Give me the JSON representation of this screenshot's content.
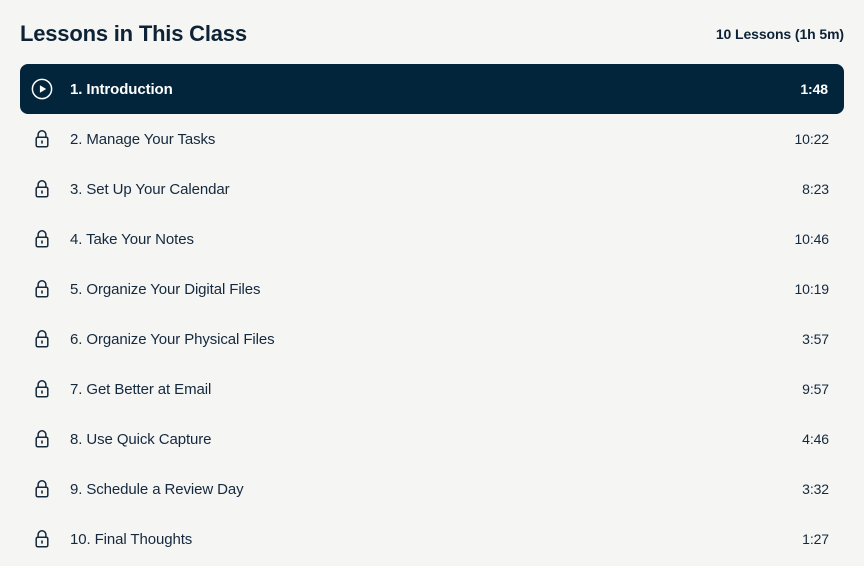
{
  "header": {
    "title": "Lessons in This Class",
    "meta": "10 Lessons (1h 5m)"
  },
  "colors": {
    "page_background": "#f5f5f4",
    "active_row_background": "#03253c",
    "text_primary": "#15293d",
    "text_heading": "#0d2235",
    "active_text": "#ffffff"
  },
  "lessons": [
    {
      "title": "1. Introduction",
      "duration": "1:48",
      "icon": "play-circle-icon",
      "state": "active"
    },
    {
      "title": "2. Manage Your Tasks",
      "duration": "10:22",
      "icon": "lock-icon",
      "state": "locked"
    },
    {
      "title": "3. Set Up Your Calendar",
      "duration": "8:23",
      "icon": "lock-icon",
      "state": "locked"
    },
    {
      "title": "4. Take Your Notes",
      "duration": "10:46",
      "icon": "lock-icon",
      "state": "locked"
    },
    {
      "title": "5. Organize Your Digital Files",
      "duration": "10:19",
      "icon": "lock-icon",
      "state": "locked"
    },
    {
      "title": "6. Organize Your Physical Files",
      "duration": "3:57",
      "icon": "lock-icon",
      "state": "locked"
    },
    {
      "title": "7. Get Better at Email",
      "duration": "9:57",
      "icon": "lock-icon",
      "state": "locked"
    },
    {
      "title": "8. Use Quick Capture",
      "duration": "4:46",
      "icon": "lock-icon",
      "state": "locked"
    },
    {
      "title": "9. Schedule a Review Day",
      "duration": "3:32",
      "icon": "lock-icon",
      "state": "locked"
    },
    {
      "title": "10. Final Thoughts",
      "duration": "1:27",
      "icon": "lock-icon",
      "state": "locked"
    }
  ]
}
